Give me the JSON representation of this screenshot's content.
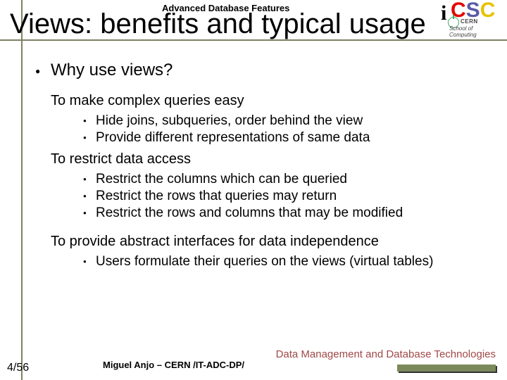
{
  "header": {
    "small": "Advanced Database Features",
    "title": "Views: benefits and typical usage"
  },
  "logo": {
    "text": "iCSC",
    "cern": "CERN",
    "sub": "School of Computing"
  },
  "content": {
    "q": "Why use views?",
    "s1": {
      "h": "To make complex queries easy",
      "b1": "Hide joins, subqueries, order behind the view",
      "b2": "Provide different representations of same data"
    },
    "s2": {
      "h": "To restrict data access",
      "b1": "Restrict the columns which can be queried",
      "b2": "Restrict the rows that queries may return",
      "b3": "Restrict the rows and columns that may be modified"
    },
    "s3": {
      "h": "To provide abstract interfaces for data independence",
      "b1": "Users formulate their queries on the views (virtual tables)"
    }
  },
  "footer": {
    "page": "4/56",
    "author": "Miguel Anjo – CERN /IT-ADC-DP/",
    "topic": "Data Management and Database Technologies"
  }
}
